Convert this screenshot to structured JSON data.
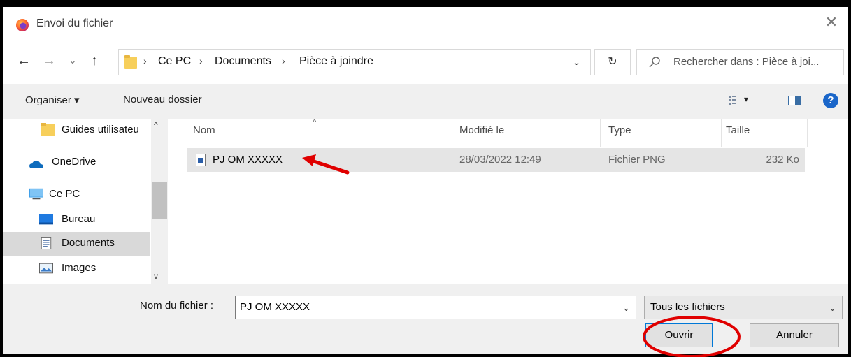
{
  "window": {
    "title": "Envoi du fichier",
    "close_glyph": "✕",
    "app_icon": "firefox-icon"
  },
  "nav_buttons": {
    "back": "←",
    "forward": "→",
    "recent": "⌄",
    "up": "↑"
  },
  "breadcrumb": {
    "separator": "›",
    "items": [
      "Ce PC",
      "Documents",
      "Pièce à joindre"
    ],
    "dropdown_glyph": "⌄"
  },
  "refresh_glyph": "↻",
  "search": {
    "placeholder": "Rechercher dans : Pièce à joi..."
  },
  "toolbar": {
    "organize": "Organiser ▾",
    "new_folder": "Nouveau dossier",
    "view_menu_caret": "▾",
    "help": "?"
  },
  "nav_pane": {
    "items": [
      {
        "label": "Guides utilisateu",
        "icon": "folder-icon"
      },
      {
        "label": "OneDrive",
        "icon": "cloud-icon"
      },
      {
        "label": "Ce PC",
        "icon": "computer-icon"
      },
      {
        "label": "Bureau",
        "icon": "desktop-icon"
      },
      {
        "label": "Documents",
        "icon": "documents-icon",
        "selected": true
      },
      {
        "label": "Images",
        "icon": "images-icon"
      }
    ],
    "scroll_up": "^",
    "scroll_down": "v"
  },
  "file_list": {
    "columns": [
      "Nom",
      "Modifié le",
      "Type",
      "Taille"
    ],
    "sort_caret": "^",
    "rows": [
      {
        "name": "PJ OM XXXXX",
        "modified": "28/03/2022 12:49",
        "type": "Fichier PNG",
        "size": "232 Ko",
        "icon": "png-file-icon",
        "selected": true
      }
    ]
  },
  "bottom": {
    "filename_label": "Nom du fichier :",
    "filename_value": "PJ OM XXXXX",
    "dropdown_glyph": "⌄",
    "filetype_value": "Tous les fichiers",
    "open_label": "Ouvrir",
    "cancel_label": "Annuler"
  },
  "annotation_colors": {
    "arrow": "#e00000",
    "circle": "#e00000"
  }
}
